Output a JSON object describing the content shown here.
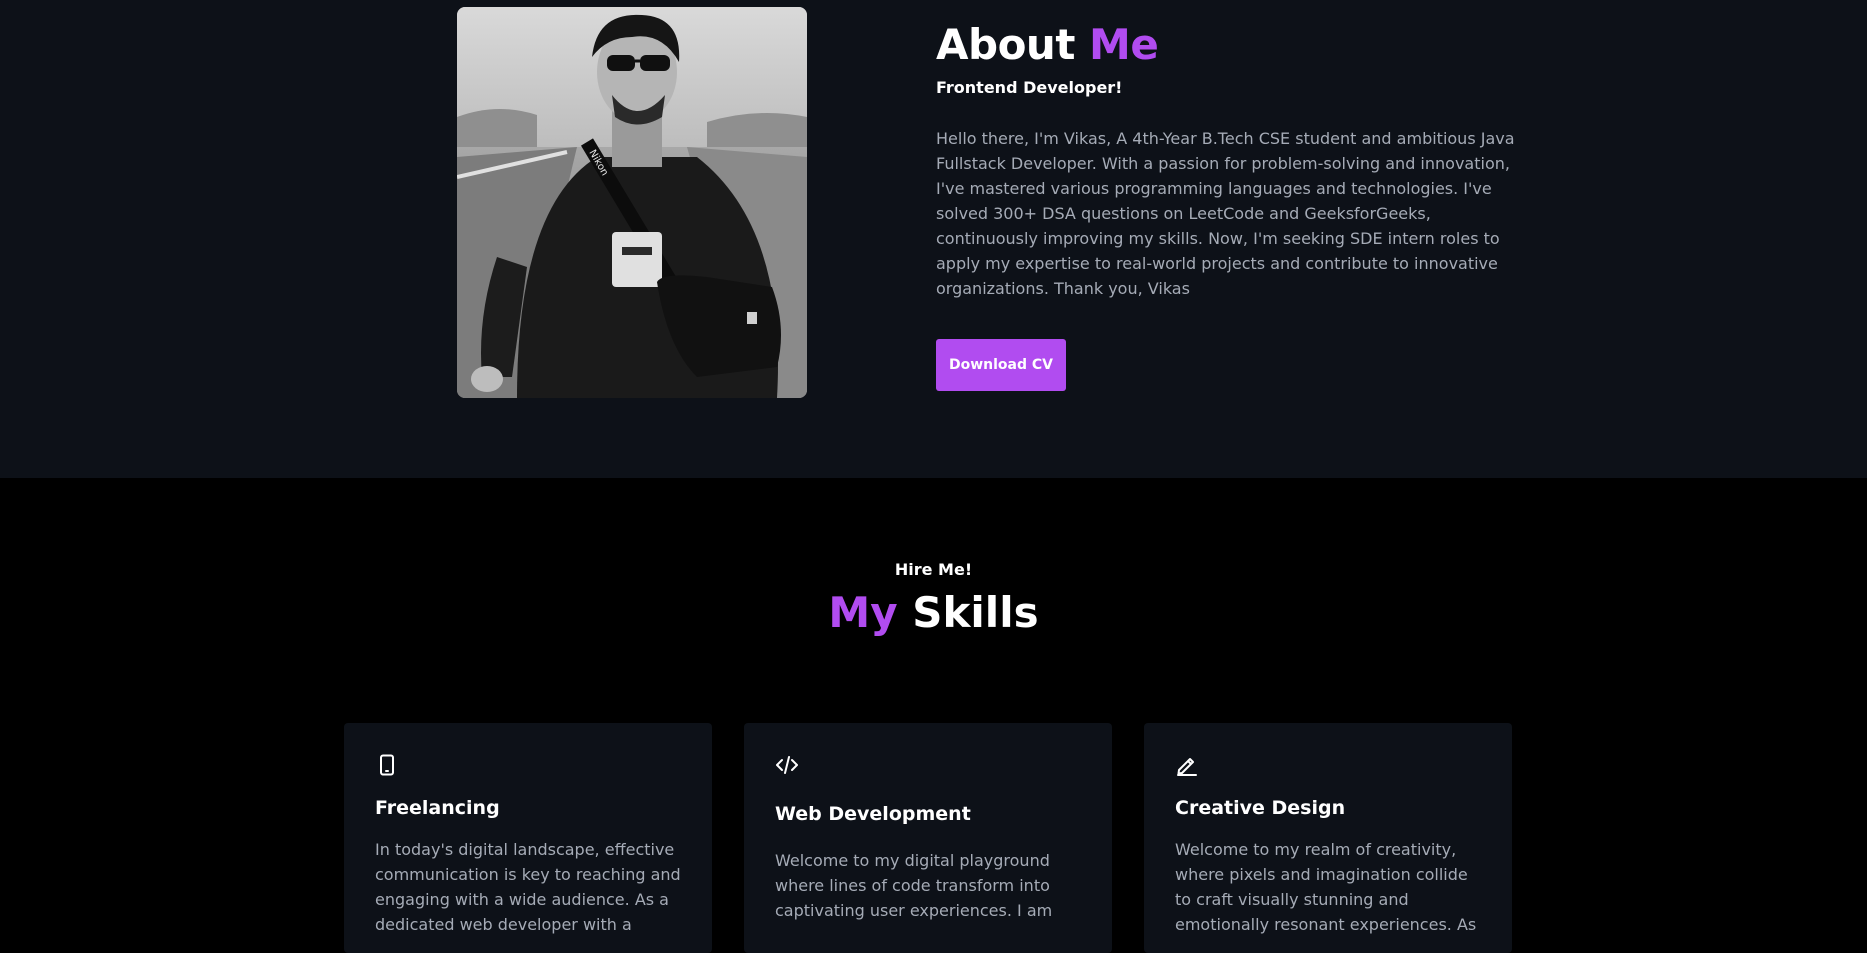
{
  "about": {
    "title_part1": "About ",
    "title_part2": "Me",
    "subtitle": "Frontend Developer!",
    "paragraph": "Hello there, I'm Vikas, A 4th-Year B.Tech CSE student and ambitious Java Fullstack Developer. With a passion for problem-solving and innovation, I've mastered various programming languages and technologies. I've solved 300+ DSA questions on LeetCode and GeeksforGeeks, continuously improving my skills. Now, I'm seeking SDE intern roles to apply my expertise to real-world projects and contribute to innovative organizations. Thank you, Vikas",
    "button_label": "Download CV",
    "photo_icon": "profile-photo"
  },
  "skills": {
    "kicker": "Hire Me!",
    "title_part1": "My",
    "title_part2": " Skills",
    "cards": [
      {
        "icon": "smartphone-icon",
        "title": "Freelancing",
        "description": "In today's digital landscape, effective communication is key to reaching and engaging with a wide audience. As a dedicated web developer with a"
      },
      {
        "icon": "code-icon",
        "title": "Web Development",
        "description": "Welcome to my digital playground where lines of code transform into captivating user experiences. I am"
      },
      {
        "icon": "pencil-icon",
        "title": "Creative Design",
        "description": "Welcome to my realm of creativity, where pixels and imagination collide to craft visually stunning and emotionally resonant experiences. As"
      }
    ]
  },
  "colors": {
    "accent": "#b14cf0",
    "about_bg": "#0d1118",
    "skills_bg": "#000000",
    "card_bg": "#0d1118",
    "body_text": "#a5abb6"
  }
}
